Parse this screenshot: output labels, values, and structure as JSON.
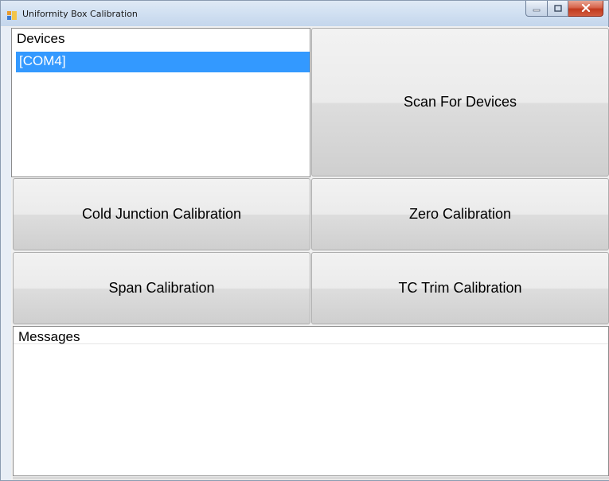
{
  "window": {
    "title": "Uniformity Box Calibration",
    "icons": {
      "app": "app-icon",
      "minimize": "minimize-icon",
      "maximize": "maximize-icon",
      "close": "close-icon"
    }
  },
  "devices": {
    "header": "Devices",
    "items": [
      {
        "label": "[COM4]",
        "selected": true
      }
    ]
  },
  "buttons": {
    "scan": "Scan For Devices",
    "cold_junction": "Cold Junction Calibration",
    "zero": "Zero Calibration",
    "span": "Span Calibration",
    "tc_trim": "TC Trim Calibration"
  },
  "messages": {
    "header": "Messages",
    "content": ""
  },
  "colors": {
    "selection": "#3399ff",
    "close_button": "#c13a1e"
  }
}
